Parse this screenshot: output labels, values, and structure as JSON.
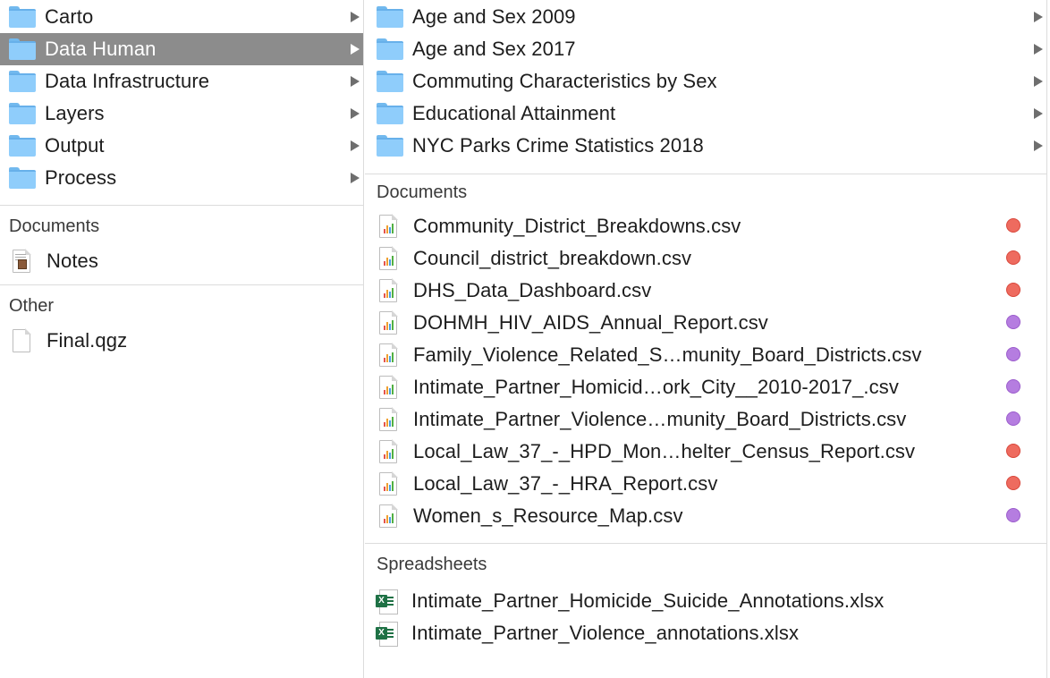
{
  "colors": {
    "selection": "#8c8c8c",
    "folder": "#8fcdfb",
    "tag_red": "#ee6b5f",
    "tag_purple": "#b57de0",
    "excel_green": "#1e7145"
  },
  "column1": {
    "folders": [
      {
        "label": "Carto",
        "icon": "folder-icon"
      },
      {
        "label": "Data Human",
        "icon": "folder-icon",
        "selected": true
      },
      {
        "label": "Data Infrastructure",
        "icon": "folder-icon"
      },
      {
        "label": "Layers",
        "icon": "folder-icon"
      },
      {
        "label": "Output",
        "icon": "folder-icon"
      },
      {
        "label": "Process",
        "icon": "folder-icon"
      }
    ],
    "documents_header": "Documents",
    "documents": [
      {
        "label": "Notes",
        "icon": "document-icon"
      }
    ],
    "other_header": "Other",
    "other": [
      {
        "label": "Final.qgz",
        "icon": "blank-file-icon"
      }
    ]
  },
  "column2": {
    "folders": [
      {
        "label": "Age and Sex 2009",
        "icon": "folder-icon"
      },
      {
        "label": "Age and Sex 2017",
        "icon": "folder-icon"
      },
      {
        "label": "Commuting Characteristics by Sex",
        "icon": "folder-icon"
      },
      {
        "label": "Educational Attainment",
        "icon": "folder-icon"
      },
      {
        "label": "NYC Parks Crime Statistics 2018",
        "icon": "folder-icon"
      }
    ],
    "documents_header": "Documents",
    "documents": [
      {
        "label": "Community_District_Breakdowns.csv",
        "tag": "red"
      },
      {
        "label": "Council_district_breakdown.csv",
        "tag": "red"
      },
      {
        "label": "DHS_Data_Dashboard.csv",
        "tag": "red"
      },
      {
        "label": "DOHMH_HIV_AIDS_Annual_Report.csv",
        "tag": "purple"
      },
      {
        "label": "Family_Violence_Related_S…munity_Board_Districts.csv",
        "tag": "purple"
      },
      {
        "label": "Intimate_Partner_Homicid…ork_City__2010-2017_.csv",
        "tag": "purple"
      },
      {
        "label": "Intimate_Partner_Violence…munity_Board_Districts.csv",
        "tag": "purple"
      },
      {
        "label": "Local_Law_37_-_HPD_Mon…helter_Census_Report.csv",
        "tag": "red"
      },
      {
        "label": "Local_Law_37_-_HRA_Report.csv",
        "tag": "red"
      },
      {
        "label": "Women_s_Resource_Map.csv",
        "tag": "purple"
      }
    ],
    "spreadsheets_header": "Spreadsheets",
    "spreadsheets": [
      {
        "label": "Intimate_Partner_Homicide_Suicide_Annotations.xlsx",
        "icon": "excel-icon"
      },
      {
        "label": "Intimate_Partner_Violence_annotations.xlsx",
        "icon": "excel-icon"
      }
    ]
  }
}
